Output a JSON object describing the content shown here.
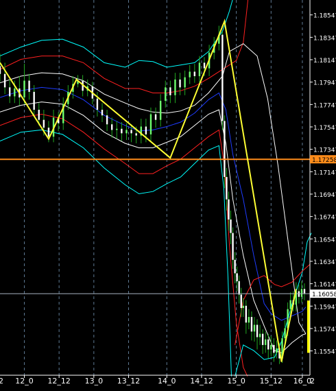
{
  "chart_data": {
    "type": "line",
    "y_ticks": [
      "1.18547",
      "1.18347",
      "1.18147",
      "1.17947",
      "1.17747",
      "1.17547",
      "1.17347",
      "1.17147",
      "1.16947",
      "1.16747",
      "1.16547",
      "1.16347",
      "1.16147",
      "1.15947",
      "1.15747",
      "1.15547"
    ],
    "x_ticks": [
      "12_0",
      "12_12",
      "13_0",
      "13_12",
      "14_0",
      "14_12",
      "15_0",
      "15_12",
      "16_0"
    ],
    "x_edge_labels": [
      "2",
      "2"
    ],
    "current_price": "1.16058",
    "level_price": "1.17258",
    "ylim": [
      1.1533,
      1.1868
    ],
    "x_range": [
      0,
      44
    ],
    "x_tick_values": [
      3.5,
      8.5,
      13.5,
      18.5,
      24.0,
      29.0,
      34.0,
      39.0,
      43.5
    ],
    "zigzag": [
      [
        0,
        1.1812
      ],
      [
        7,
        1.1744
      ],
      [
        11,
        1.1797
      ],
      [
        24.5,
        1.1727
      ],
      [
        32.3,
        1.1849
      ],
      [
        40.5,
        1.1545
      ],
      [
        42.6,
        1.161
      ]
    ],
    "series": [
      {
        "color": "#00ffff",
        "points": [
          [
            0,
            1.1818
          ],
          [
            3,
            1.1826
          ],
          [
            6,
            1.1832
          ],
          [
            9,
            1.1833
          ],
          [
            12,
            1.1826
          ],
          [
            15,
            1.1812
          ],
          [
            18,
            1.1808
          ],
          [
            20,
            1.1814
          ],
          [
            22,
            1.1813
          ],
          [
            24,
            1.1808
          ],
          [
            26,
            1.181
          ],
          [
            28,
            1.1812
          ],
          [
            30,
            1.1822
          ],
          [
            32,
            1.184
          ],
          [
            33,
            1.1858
          ],
          [
            34,
            1.188
          ]
        ]
      },
      {
        "color": "#ff2020",
        "points": [
          [
            0,
            1.1806
          ],
          [
            3,
            1.1815
          ],
          [
            6,
            1.1818
          ],
          [
            9,
            1.1818
          ],
          [
            12,
            1.1812
          ],
          [
            15,
            1.1798
          ],
          [
            18,
            1.1789
          ],
          [
            20,
            1.1789
          ],
          [
            22,
            1.1785
          ],
          [
            24,
            1.1785
          ],
          [
            26,
            1.1787
          ],
          [
            28,
            1.1791
          ],
          [
            30,
            1.1798
          ],
          [
            32,
            1.1806
          ],
          [
            34,
            1.1814
          ],
          [
            35,
            1.183
          ],
          [
            35.7,
            1.187
          ]
        ]
      },
      {
        "color": "#ffffff",
        "points": [
          [
            0,
            1.1794
          ],
          [
            3,
            1.18
          ],
          [
            6,
            1.1803
          ],
          [
            9,
            1.1802
          ],
          [
            12,
            1.1796
          ],
          [
            15,
            1.1784
          ],
          [
            18,
            1.1776
          ],
          [
            20,
            1.1771
          ],
          [
            22,
            1.1768
          ],
          [
            24,
            1.1767
          ],
          [
            26,
            1.1769
          ],
          [
            28,
            1.1774
          ],
          [
            30,
            1.1785
          ],
          [
            32,
            1.18
          ],
          [
            33,
            1.1822
          ],
          [
            35,
            1.1829
          ],
          [
            37,
            1.1818
          ],
          [
            38.5,
            1.178
          ],
          [
            40,
            1.172
          ],
          [
            41.5,
            1.165
          ],
          [
            43,
            1.158
          ],
          [
            44,
            1.157
          ]
        ]
      },
      {
        "color": "#1e3cff",
        "points": [
          [
            0,
            1.1781
          ],
          [
            3,
            1.1787
          ],
          [
            6,
            1.179
          ],
          [
            9,
            1.1788
          ],
          [
            12,
            1.1779
          ],
          [
            15,
            1.1765
          ],
          [
            18,
            1.1756
          ],
          [
            20,
            1.1751
          ],
          [
            22,
            1.1752
          ],
          [
            24,
            1.1755
          ],
          [
            26,
            1.1759
          ],
          [
            28,
            1.1767
          ],
          [
            30,
            1.1779
          ],
          [
            31.5,
            1.1785
          ],
          [
            32.5,
            1.177
          ],
          [
            33.5,
            1.173
          ],
          [
            35,
            1.169
          ],
          [
            36.5,
            1.164
          ],
          [
            38,
            1.1597
          ],
          [
            39,
            1.1588
          ],
          [
            40.5,
            1.1582
          ],
          [
            42,
            1.1586
          ],
          [
            43.5,
            1.159
          ],
          [
            44,
            1.1594
          ]
        ]
      },
      {
        "color": "#ffffff",
        "points": [
          [
            0,
            1.1768
          ],
          [
            3,
            1.1774
          ],
          [
            6,
            1.1777
          ],
          [
            9,
            1.1775
          ],
          [
            12,
            1.1765
          ],
          [
            15,
            1.175
          ],
          [
            18,
            1.174
          ],
          [
            20,
            1.1736
          ],
          [
            22,
            1.1736
          ],
          [
            24,
            1.1741
          ],
          [
            26,
            1.1746
          ],
          [
            28,
            1.1756
          ],
          [
            30,
            1.1766
          ],
          [
            31.5,
            1.177
          ],
          [
            32.5,
            1.174
          ],
          [
            33.5,
            1.169
          ],
          [
            35,
            1.164
          ],
          [
            36.5,
            1.16
          ],
          [
            38,
            1.1577
          ],
          [
            39.5,
            1.1555
          ],
          [
            40.5,
            1.1553
          ],
          [
            42,
            1.1562
          ],
          [
            43.5,
            1.1569
          ],
          [
            44,
            1.157
          ]
        ]
      },
      {
        "color": "#ff2020",
        "points": [
          [
            0,
            1.1756
          ],
          [
            3,
            1.1763
          ],
          [
            6,
            1.1766
          ],
          [
            9,
            1.1762
          ],
          [
            12,
            1.175
          ],
          [
            15,
            1.1735
          ],
          [
            18,
            1.1722
          ],
          [
            20,
            1.1713
          ],
          [
            22,
            1.1713
          ],
          [
            24,
            1.172
          ],
          [
            26,
            1.1726
          ],
          [
            28,
            1.1736
          ],
          [
            30,
            1.1746
          ],
          [
            31.5,
            1.1752
          ],
          [
            32.3,
            1.172
          ],
          [
            33,
            1.165
          ],
          [
            34,
            1.158
          ],
          [
            35,
            1.154
          ],
          [
            35.6,
            1.1532
          ]
        ]
      },
      {
        "color": "#00ffff",
        "points": [
          [
            0,
            1.1742
          ],
          [
            3,
            1.175
          ],
          [
            6,
            1.1752
          ],
          [
            9,
            1.1748
          ],
          [
            12,
            1.1736
          ],
          [
            15,
            1.1718
          ],
          [
            18,
            1.1703
          ],
          [
            20,
            1.1695
          ],
          [
            22,
            1.1697
          ],
          [
            24,
            1.1704
          ],
          [
            26,
            1.171
          ],
          [
            28,
            1.1722
          ],
          [
            30,
            1.1734
          ],
          [
            31.5,
            1.1738
          ],
          [
            32.2,
            1.17
          ],
          [
            32.8,
            1.162
          ],
          [
            33.3,
            1.1532
          ]
        ]
      },
      {
        "color": "#00ffff",
        "points": [
          [
            33.8,
            1.1532
          ],
          [
            35,
            1.156
          ],
          [
            36.5,
            1.1555
          ],
          [
            38,
            1.1547
          ],
          [
            39.5,
            1.1549
          ],
          [
            40.5,
            1.1563
          ],
          [
            42,
            1.1596
          ],
          [
            43.5,
            1.1625
          ],
          [
            44.2,
            1.1652
          ],
          [
            44.8,
            1.166
          ]
        ]
      },
      {
        "color": "#ff2020",
        "points": [
          [
            33.8,
            1.156
          ],
          [
            35,
            1.16
          ],
          [
            36.5,
            1.1618
          ],
          [
            38,
            1.1622
          ],
          [
            39.5,
            1.1614
          ],
          [
            40.5,
            1.1612
          ],
          [
            42,
            1.1616
          ],
          [
            43.5,
            1.1626
          ],
          [
            44.6,
            1.1632
          ]
        ]
      }
    ],
    "candles": [
      [
        0.0,
        1.1809,
        1.1802,
        1.182,
        1.1795
      ],
      [
        0.7,
        1.1802,
        1.179,
        1.1812,
        1.1784
      ],
      [
        1.4,
        1.179,
        1.1782,
        1.1798,
        1.1776
      ],
      [
        2.1,
        1.1782,
        1.1789,
        1.1796,
        1.1776
      ],
      [
        2.8,
        1.1789,
        1.1781,
        1.18,
        1.1774
      ],
      [
        3.5,
        1.1781,
        1.1796,
        1.1811,
        1.1775
      ],
      [
        4.2,
        1.1796,
        1.1786,
        1.1802,
        1.1779
      ],
      [
        4.9,
        1.1786,
        1.177,
        1.1792,
        1.1765
      ],
      [
        5.6,
        1.177,
        1.1761,
        1.1776,
        1.1756
      ],
      [
        6.3,
        1.1761,
        1.1754,
        1.177,
        1.1747
      ],
      [
        7.0,
        1.1754,
        1.1746,
        1.176,
        1.1741
      ],
      [
        7.7,
        1.1746,
        1.1763,
        1.177,
        1.1741
      ],
      [
        8.4,
        1.1763,
        1.1758,
        1.1768,
        1.1751
      ],
      [
        9.1,
        1.1758,
        1.1775,
        1.1781,
        1.1752
      ],
      [
        9.8,
        1.1775,
        1.1786,
        1.1792,
        1.177
      ],
      [
        10.5,
        1.1786,
        1.1793,
        1.18,
        1.178
      ],
      [
        11.2,
        1.1793,
        1.1796,
        1.1801,
        1.179
      ],
      [
        11.9,
        1.1796,
        1.1787,
        1.1801,
        1.1782
      ],
      [
        12.6,
        1.1787,
        1.1791,
        1.1797,
        1.1782
      ],
      [
        13.3,
        1.1791,
        1.178,
        1.1795,
        1.1775
      ],
      [
        14.0,
        1.178,
        1.177,
        1.1786,
        1.1764
      ],
      [
        14.7,
        1.177,
        1.1765,
        1.1776,
        1.1759
      ],
      [
        15.4,
        1.1765,
        1.1757,
        1.177,
        1.1751
      ],
      [
        16.1,
        1.1757,
        1.1752,
        1.1763,
        1.1745
      ],
      [
        16.8,
        1.1752,
        1.1753,
        1.176,
        1.1744
      ],
      [
        17.5,
        1.1753,
        1.1749,
        1.1759,
        1.1742
      ],
      [
        18.2,
        1.1749,
        1.1752,
        1.1758,
        1.1743
      ],
      [
        18.9,
        1.1752,
        1.1749,
        1.1757,
        1.1741
      ],
      [
        19.6,
        1.1749,
        1.1747,
        1.1755,
        1.174
      ],
      [
        20.3,
        1.1747,
        1.1755,
        1.1762,
        1.174
      ],
      [
        21.0,
        1.1755,
        1.1748,
        1.1762,
        1.1741
      ],
      [
        21.7,
        1.1748,
        1.1766,
        1.1772,
        1.1741
      ],
      [
        22.4,
        1.1766,
        1.1761,
        1.1772,
        1.1754
      ],
      [
        23.1,
        1.1761,
        1.1778,
        1.1784,
        1.1755
      ],
      [
        23.8,
        1.1778,
        1.179,
        1.1796,
        1.1772
      ],
      [
        24.5,
        1.179,
        1.1783,
        1.1796,
        1.1776
      ],
      [
        25.2,
        1.1783,
        1.1797,
        1.1803,
        1.1776
      ],
      [
        25.9,
        1.1797,
        1.179,
        1.1803,
        1.1783
      ],
      [
        26.6,
        1.179,
        1.1799,
        1.1805,
        1.1783
      ],
      [
        27.3,
        1.1799,
        1.1804,
        1.181,
        1.1793
      ],
      [
        28.0,
        1.1804,
        1.18,
        1.1811,
        1.1794
      ],
      [
        28.7,
        1.18,
        1.1812,
        1.1818,
        1.1794
      ],
      [
        29.4,
        1.1812,
        1.1807,
        1.1817,
        1.18
      ],
      [
        30.1,
        1.1807,
        1.1821,
        1.1828,
        1.18
      ],
      [
        30.8,
        1.1821,
        1.1829,
        1.1835,
        1.1815
      ],
      [
        31.5,
        1.1829,
        1.1837,
        1.1845,
        1.1823
      ],
      [
        32.0,
        1.1837,
        1.176,
        1.184,
        1.1752
      ],
      [
        32.3,
        1.176,
        1.171,
        1.1765,
        1.17
      ],
      [
        32.6,
        1.171,
        1.169,
        1.1718,
        1.168
      ],
      [
        32.9,
        1.169,
        1.1672,
        1.1697,
        1.1662
      ],
      [
        33.2,
        1.1672,
        1.166,
        1.168,
        1.165
      ],
      [
        33.5,
        1.166,
        1.1636,
        1.1665,
        1.1628
      ],
      [
        33.8,
        1.1636,
        1.1624,
        1.1643,
        1.1615
      ],
      [
        34.1,
        1.1624,
        1.1617,
        1.163,
        1.1608
      ],
      [
        34.4,
        1.1617,
        1.1605,
        1.1622,
        1.1597
      ],
      [
        34.7,
        1.1605,
        1.1593,
        1.1611,
        1.1585
      ],
      [
        35.0,
        1.1593,
        1.1595,
        1.1602,
        1.1585
      ],
      [
        35.4,
        1.1595,
        1.158,
        1.16,
        1.157
      ],
      [
        35.8,
        1.158,
        1.1585,
        1.1592,
        1.1574
      ],
      [
        36.2,
        1.1585,
        1.1572,
        1.159,
        1.1564
      ],
      [
        36.6,
        1.1572,
        1.1578,
        1.1585,
        1.1563
      ],
      [
        37.0,
        1.1578,
        1.1567,
        1.1583,
        1.1556
      ],
      [
        37.4,
        1.1567,
        1.157,
        1.1578,
        1.156
      ],
      [
        37.8,
        1.157,
        1.156,
        1.1574,
        1.1552
      ],
      [
        38.2,
        1.156,
        1.1565,
        1.1572,
        1.1553
      ],
      [
        38.6,
        1.1565,
        1.1556,
        1.157,
        1.1548
      ],
      [
        39.0,
        1.1556,
        1.156,
        1.1568,
        1.155
      ],
      [
        39.4,
        1.156,
        1.1553,
        1.1566,
        1.1545
      ],
      [
        39.8,
        1.1553,
        1.1557,
        1.1564,
        1.1548
      ],
      [
        40.2,
        1.1557,
        1.1548,
        1.1562,
        1.1543
      ],
      [
        40.6,
        1.1548,
        1.1566,
        1.1572,
        1.1544
      ],
      [
        41.0,
        1.1566,
        1.1575,
        1.1582,
        1.156
      ],
      [
        41.4,
        1.1575,
        1.1592,
        1.1598,
        1.1568
      ],
      [
        41.8,
        1.1592,
        1.16,
        1.1607,
        1.1587
      ],
      [
        42.2,
        1.16,
        1.1596,
        1.1608,
        1.159
      ],
      [
        42.6,
        1.1596,
        1.1608,
        1.1616,
        1.159
      ],
      [
        43.0,
        1.1608,
        1.1603,
        1.1614,
        1.1597
      ],
      [
        43.4,
        1.1603,
        1.161,
        1.1617,
        1.1598
      ],
      [
        43.8,
        1.161,
        1.1606,
        1.1615,
        1.16
      ]
    ]
  }
}
